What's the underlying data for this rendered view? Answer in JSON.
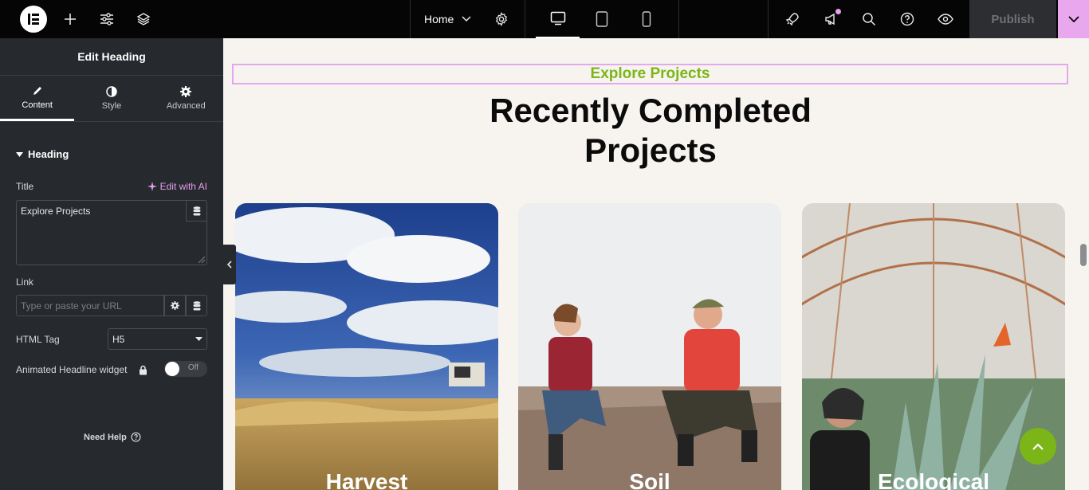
{
  "topbar": {
    "page_selector": "Home",
    "publish_label": "Publish",
    "icons": [
      "elementor-logo-icon",
      "plus-icon",
      "sliders-icon",
      "layers-icon",
      "chevron-down-icon",
      "gear-icon",
      "desktop-icon",
      "tablet-icon",
      "mobile-icon",
      "rocket-icon",
      "megaphone-icon",
      "search-icon",
      "help-icon",
      "eye-icon"
    ]
  },
  "panel": {
    "header": "Edit Heading",
    "tabs": [
      {
        "label": "Content",
        "icon": "pencil-icon",
        "active": true
      },
      {
        "label": "Style",
        "icon": "half-circle-icon",
        "active": false
      },
      {
        "label": "Advanced",
        "icon": "gear-icon",
        "active": false
      }
    ],
    "section": "Heading",
    "title_label": "Title",
    "edit_ai": "Edit with AI",
    "title_value": "Explore Projects",
    "link_label": "Link",
    "link_placeholder": "Type or paste your URL",
    "html_tag_label": "HTML Tag",
    "html_tag_value": "H5",
    "animated_label": "Animated Headline widget",
    "toggle_text": "Off",
    "need_help": "Need Help"
  },
  "canvas": {
    "eyebrow": "Explore Projects",
    "headline_line1": "Recently Completed",
    "headline_line2": "Projects",
    "cards": [
      {
        "title": "Harvest"
      },
      {
        "title": "Soil"
      },
      {
        "title": "Ecological"
      }
    ]
  },
  "colors": {
    "accent_green": "#7cb518",
    "accent_pink": "#e79ef0",
    "panel_bg": "#26292d",
    "topbar_bg": "#050505"
  }
}
